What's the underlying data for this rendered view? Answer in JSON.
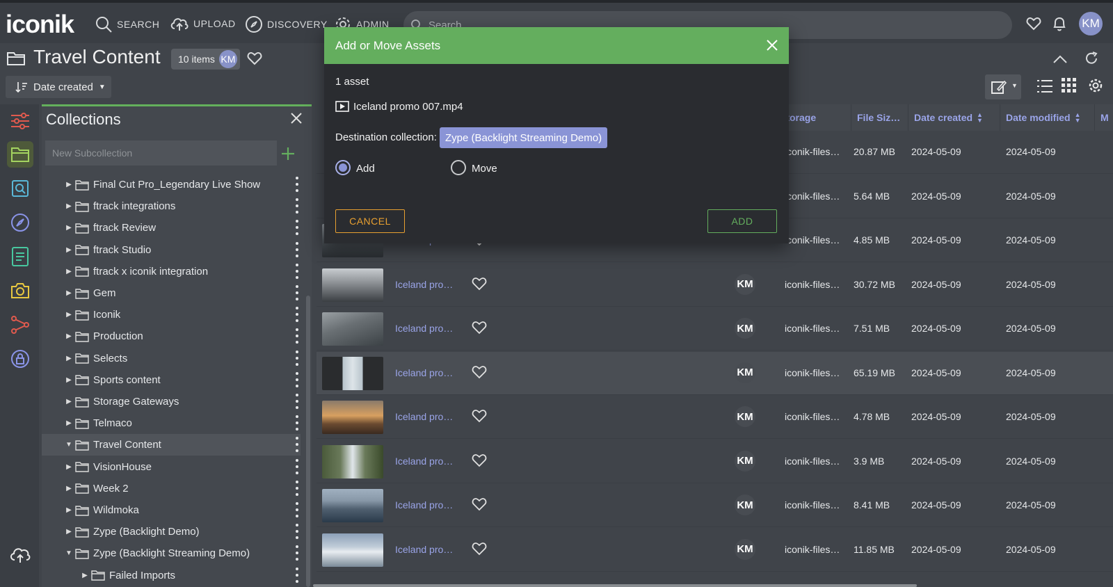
{
  "app": {
    "logo": "iconik"
  },
  "nav": {
    "search": "SEARCH",
    "upload": "UPLOAD",
    "discovery": "DISCOVERY",
    "admin": "ADMIN",
    "search_placeholder": "Search",
    "user_initials": "KM"
  },
  "header": {
    "title": "Travel Content",
    "item_count": "10 items",
    "owner_initials": "KM",
    "sort_label": "Date created"
  },
  "collections": {
    "title": "Collections",
    "new_subcollection_placeholder": "New Subcollection",
    "items": [
      {
        "label": "Final Cut Pro_Legendary Live Show",
        "expanded": false
      },
      {
        "label": "ftrack integrations",
        "expanded": false
      },
      {
        "label": "ftrack Review",
        "expanded": false
      },
      {
        "label": "ftrack Studio",
        "expanded": false
      },
      {
        "label": "ftrack x iconik integration",
        "expanded": false
      },
      {
        "label": "Gem",
        "expanded": false
      },
      {
        "label": "Iconik",
        "expanded": false
      },
      {
        "label": "Production",
        "expanded": false
      },
      {
        "label": "Selects",
        "expanded": false
      },
      {
        "label": "Sports content",
        "expanded": false
      },
      {
        "label": "Storage Gateways",
        "expanded": false
      },
      {
        "label": "Telmaco",
        "expanded": false
      },
      {
        "label": "Travel Content",
        "expanded": true
      },
      {
        "label": "VisionHouse",
        "expanded": false
      },
      {
        "label": "Week 2",
        "expanded": false
      },
      {
        "label": "Wildmoka",
        "expanded": false
      },
      {
        "label": "Zype (Backlight Demo)",
        "expanded": false
      },
      {
        "label": "Zype (Backlight Streaming Demo)",
        "expanded": true
      },
      {
        "label": "Failed Imports",
        "expanded": false
      }
    ]
  },
  "table": {
    "columns": {
      "storage": "Storage",
      "file_size": "File Siz…",
      "date_created": "Date created",
      "date_modified": "Date modified",
      "more": "M"
    },
    "rows": [
      {
        "name": "",
        "owner": "",
        "storage": "iconik-files…",
        "size": "20.87 MB",
        "created": "2024-05-09",
        "modified": "2024-05-09"
      },
      {
        "name": "",
        "owner": "",
        "storage": "iconik-files…",
        "size": "5.64 MB",
        "created": "2024-05-09",
        "modified": "2024-05-09"
      },
      {
        "name": "Iceland pro…",
        "owner": "",
        "storage": "iconik-files…",
        "size": "4.85 MB",
        "created": "2024-05-09",
        "modified": "2024-05-09"
      },
      {
        "name": "Iceland pro…",
        "owner": "KM",
        "storage": "iconik-files…",
        "size": "30.72 MB",
        "created": "2024-05-09",
        "modified": "2024-05-09"
      },
      {
        "name": "Iceland pro…",
        "owner": "KM",
        "storage": "iconik-files…",
        "size": "7.51 MB",
        "created": "2024-05-09",
        "modified": "2024-05-09"
      },
      {
        "name": "Iceland pro…",
        "owner": "KM",
        "storage": "iconik-files…",
        "size": "65.19 MB",
        "created": "2024-05-09",
        "modified": "2024-05-09"
      },
      {
        "name": "Iceland pro…",
        "owner": "KM",
        "storage": "iconik-files…",
        "size": "4.78 MB",
        "created": "2024-05-09",
        "modified": "2024-05-09"
      },
      {
        "name": "Iceland pro…",
        "owner": "KM",
        "storage": "iconik-files…",
        "size": "3.9 MB",
        "created": "2024-05-09",
        "modified": "2024-05-09"
      },
      {
        "name": "Iceland pro…",
        "owner": "KM",
        "storage": "iconik-files…",
        "size": "8.41 MB",
        "created": "2024-05-09",
        "modified": "2024-05-09"
      },
      {
        "name": "Iceland pro…",
        "owner": "KM",
        "storage": "iconik-files…",
        "size": "11.85 MB",
        "created": "2024-05-09",
        "modified": "2024-05-09"
      }
    ]
  },
  "dialog": {
    "title": "Add or Move Assets",
    "asset_count": "1 asset",
    "asset_name": "Iceland promo 007.mp4",
    "destination_label": "Destination collection:",
    "destination_value": "Zype (Backlight Streaming Demo)",
    "option_add": "Add",
    "option_move": "Move",
    "selected_option": "Add",
    "cancel_label": "CANCEL",
    "add_label": "ADD"
  },
  "colors": {
    "accent_green": "#64ae5e",
    "accent_purple": "#8a94d6",
    "cancel_orange": "#e8a030",
    "background": "#40444a"
  }
}
